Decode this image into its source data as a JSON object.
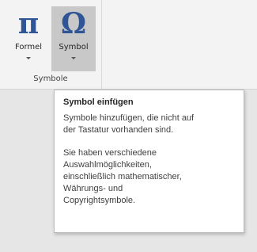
{
  "ribbon": {
    "buttons": {
      "formel": {
        "glyph": "π",
        "label": "Formel"
      },
      "symbol": {
        "glyph": "Ω",
        "label": "Symbol"
      }
    },
    "group_label": "Symbole"
  },
  "tooltip": {
    "title": "Symbol einfügen",
    "paragraph1": [
      "Symbole hinzufügen, die nicht auf",
      "der Tastatur vorhanden sind."
    ],
    "paragraph2": [
      "Sie haben verschiedene",
      "Auswahlmöglichkeiten,",
      "einschließlich mathematischer,",
      "Währungs- und",
      "Copyrightsymbole."
    ]
  },
  "colors": {
    "glyph_accent": "#2f5597",
    "ribbon_background": "#f3f3f3",
    "pressed_button": "#c8c8c8"
  },
  "icons": {
    "formel": "pi-icon",
    "symbol": "omega-icon",
    "dropdown": "chevron-down-icon"
  }
}
